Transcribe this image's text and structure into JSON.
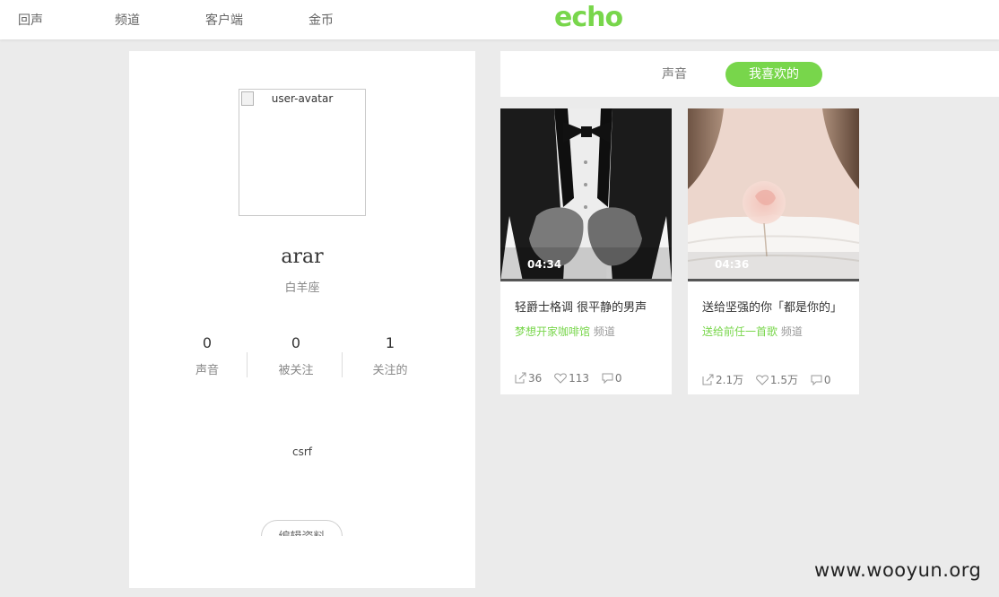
{
  "nav": {
    "items": [
      "回声",
      "频道",
      "客户端",
      "金币"
    ],
    "logo": "echo"
  },
  "colors": {
    "accent": "#78d64b",
    "background": "#ebebeb"
  },
  "profile": {
    "avatar_alt": "user-avatar",
    "username": "arar",
    "zodiac": "白羊座",
    "stats": [
      {
        "value": "0",
        "label": "声音"
      },
      {
        "value": "0",
        "label": "被关注"
      },
      {
        "value": "1",
        "label": "关注的"
      }
    ],
    "bio": "csrf",
    "edit_button": "编辑资料"
  },
  "tabs": {
    "sounds": "声音",
    "liked": "我喜欢的"
  },
  "cards": [
    {
      "duration": "04:34",
      "title": "轻爵士格调 很平静的男声",
      "channel": "梦想开家咖啡馆",
      "channel_suffix": "频道",
      "shares": "36",
      "likes": "113",
      "comments": "0"
    },
    {
      "duration": "04:36",
      "title": "送给坚强的你「都是你的」",
      "channel": "送给前任一首歌",
      "channel_suffix": "频道",
      "shares": "2.1万",
      "likes": "1.5万",
      "comments": "0"
    }
  ],
  "icons": {
    "share": "share-icon",
    "like": "heart-icon",
    "comment": "comment-icon"
  },
  "watermark": "www.wooyun.org"
}
